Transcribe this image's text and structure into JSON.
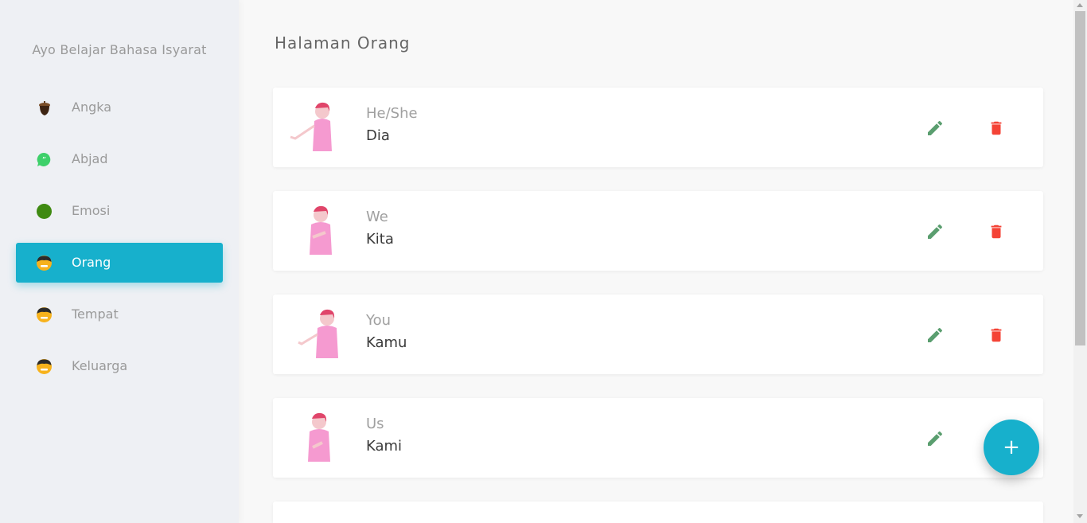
{
  "sidebar": {
    "brand": "Ayo Belajar Bahasa Isyarat",
    "items": [
      {
        "label": "Angka",
        "icon": "acorn-icon",
        "active": false
      },
      {
        "label": "Abjad",
        "icon": "chat-bubble-icon",
        "active": false
      },
      {
        "label": "Emosi",
        "icon": "circle-icon",
        "active": false
      },
      {
        "label": "Orang",
        "icon": "person-face-icon",
        "active": true
      },
      {
        "label": "Tempat",
        "icon": "person-face-icon",
        "active": false
      },
      {
        "label": "Keluarga",
        "icon": "person-face-icon",
        "active": false
      }
    ]
  },
  "main": {
    "title": "Halaman Orang",
    "cards": [
      {
        "english": "He/She",
        "indonesian": "Dia",
        "image": "sign-gesture-illustration"
      },
      {
        "english": "We",
        "indonesian": "Kita",
        "image": "sign-gesture-illustration"
      },
      {
        "english": "You",
        "indonesian": "Kamu",
        "image": "sign-gesture-illustration"
      },
      {
        "english": "Us",
        "indonesian": "Kami",
        "image": "sign-gesture-illustration"
      }
    ],
    "fab_label": "+"
  },
  "colors": {
    "accent": "#17b0cc",
    "edit": "#5a9e6f",
    "delete": "#f44336"
  }
}
